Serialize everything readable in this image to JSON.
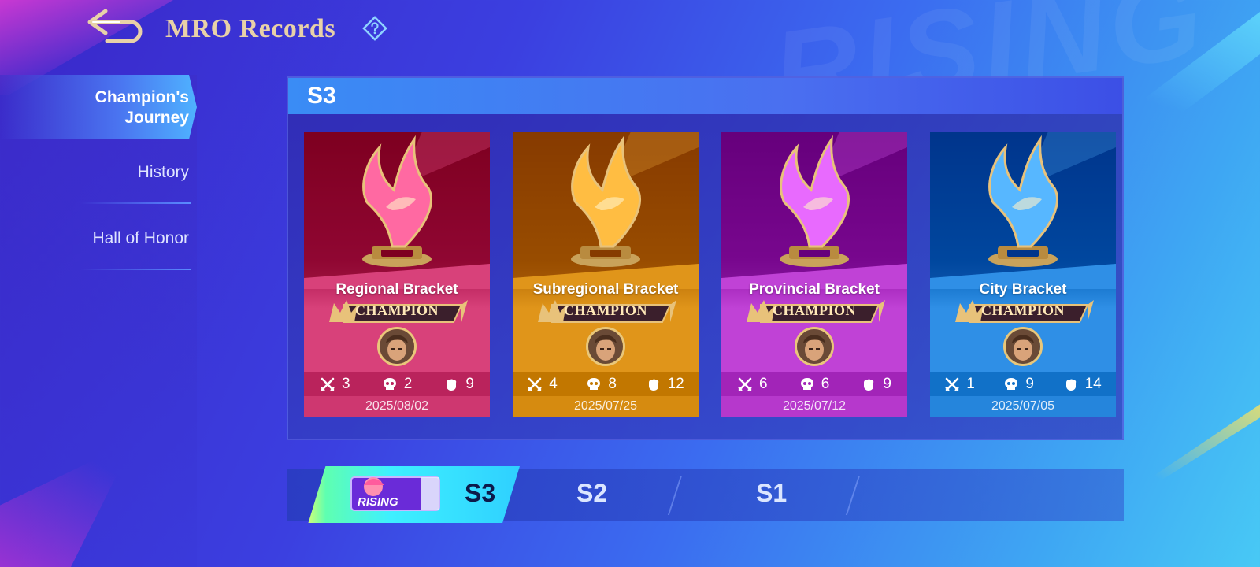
{
  "header": {
    "title": "MRO Records"
  },
  "sidebar": {
    "items": [
      {
        "label": "Champion's Journey",
        "active": true
      },
      {
        "label": "History",
        "active": false
      },
      {
        "label": "Hall of Honor",
        "active": false
      }
    ]
  },
  "panel": {
    "season_label": "S3",
    "cards": [
      {
        "bracket": "Regional Bracket",
        "title": "CHAMPION",
        "kills": "3",
        "deaths": "2",
        "assists": "9",
        "date": "2025/08/02",
        "theme": "#d8417a"
      },
      {
        "bracket": "Subregional Bracket",
        "title": "CHAMPION",
        "kills": "4",
        "deaths": "8",
        "assists": "12",
        "date": "2025/07/25",
        "theme": "#e0951a"
      },
      {
        "bracket": "Provincial Bracket",
        "title": "CHAMPION",
        "kills": "6",
        "deaths": "6",
        "assists": "9",
        "date": "2025/07/12",
        "theme": "#c042d6"
      },
      {
        "bracket": "City Bracket",
        "title": "CHAMPION",
        "kills": "1",
        "deaths": "9",
        "assists": "14",
        "date": "2025/07/05",
        "theme": "#2f8fe6"
      }
    ]
  },
  "tabs": {
    "items": [
      {
        "label": "S3",
        "active": true,
        "badge": "RISING"
      },
      {
        "label": "S2",
        "active": false
      },
      {
        "label": "S1",
        "active": false
      }
    ]
  }
}
